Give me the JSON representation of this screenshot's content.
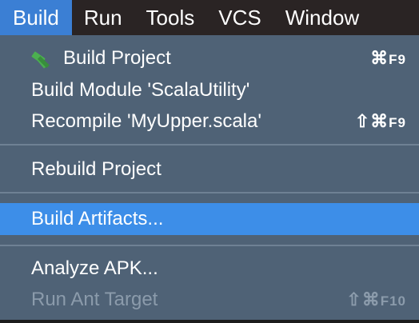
{
  "menubar": {
    "items": [
      {
        "label": "Build"
      },
      {
        "label": "Run"
      },
      {
        "label": "Tools"
      },
      {
        "label": "VCS"
      },
      {
        "label": "Window"
      }
    ]
  },
  "menu": {
    "items": [
      {
        "label": "Build Project",
        "shortcut_symbol": "⌘",
        "shortcut_key": "F9",
        "icon": "hammer-icon"
      },
      {
        "label": "Build Module 'ScalaUtility'"
      },
      {
        "label": "Recompile 'MyUpper.scala'",
        "shortcut_symbol": "⇧⌘",
        "shortcut_key": "F9"
      },
      {
        "label": "Rebuild Project"
      },
      {
        "label": "Build Artifacts..."
      },
      {
        "label": "Analyze APK..."
      },
      {
        "label": "Run Ant Target",
        "shortcut_symbol": "⇧⌘",
        "shortcut_key": "F10",
        "disabled": true
      }
    ]
  },
  "colors": {
    "menubar_bg": "#2a2424",
    "active_menu": "#3b7fd4",
    "dropdown_bg": "#4f6276",
    "highlight": "#3d8ee8",
    "disabled_text": "#8b9bab"
  }
}
